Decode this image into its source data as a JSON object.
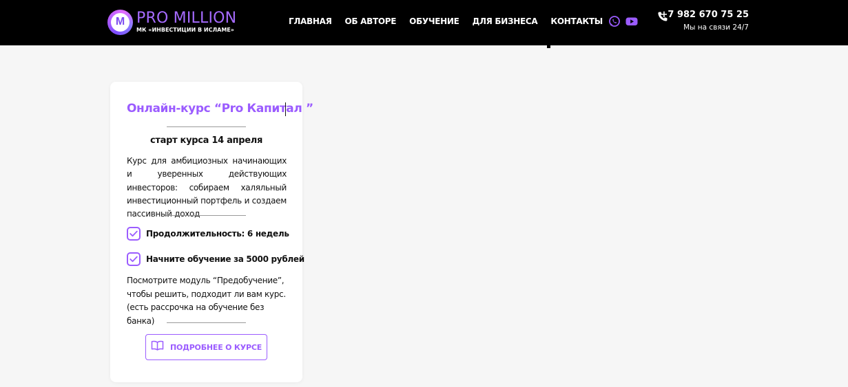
{
  "header": {
    "logo": {
      "mark": "M",
      "title": "PRO MILLION",
      "subtitle": "МК «ИНВЕСТИЦИИ В ИСЛАМЕ»"
    },
    "nav": [
      "ГЛАВНАЯ",
      "ОБ АВТОРЕ",
      "ОБУЧЕНИЕ",
      "ДЛЯ БИЗНЕСА",
      "КОНТАКТЫ"
    ],
    "social": [
      "whatsapp-icon",
      "youtube-icon"
    ],
    "phone": {
      "number": "+7 982 670 75 25",
      "note": "Мы на связи 24/7"
    }
  },
  "card": {
    "title": "Онлайн-курс “Pro Капитал ”",
    "start": "старт курса 14 апреля",
    "description": "Курс для амбициозных начинающих и уверенных действующих инвесторов: собираем халяльный инвестиционный портфель и создаем пассивный доход",
    "features": [
      "Продолжительность: 6 недель",
      "Начните обучение за 5000 рублей"
    ],
    "note": "Посмотрите модуль “Предобучение”, чтобы решить, подходит ли вам курс. (есть рассрочка на обучение без банка)",
    "cta": "ПОДРОБНЕЕ О КУРСЕ"
  },
  "colors": {
    "accent": "#9b5cff",
    "header_bg": "#000000",
    "page_bg": "#f6f6f6"
  }
}
